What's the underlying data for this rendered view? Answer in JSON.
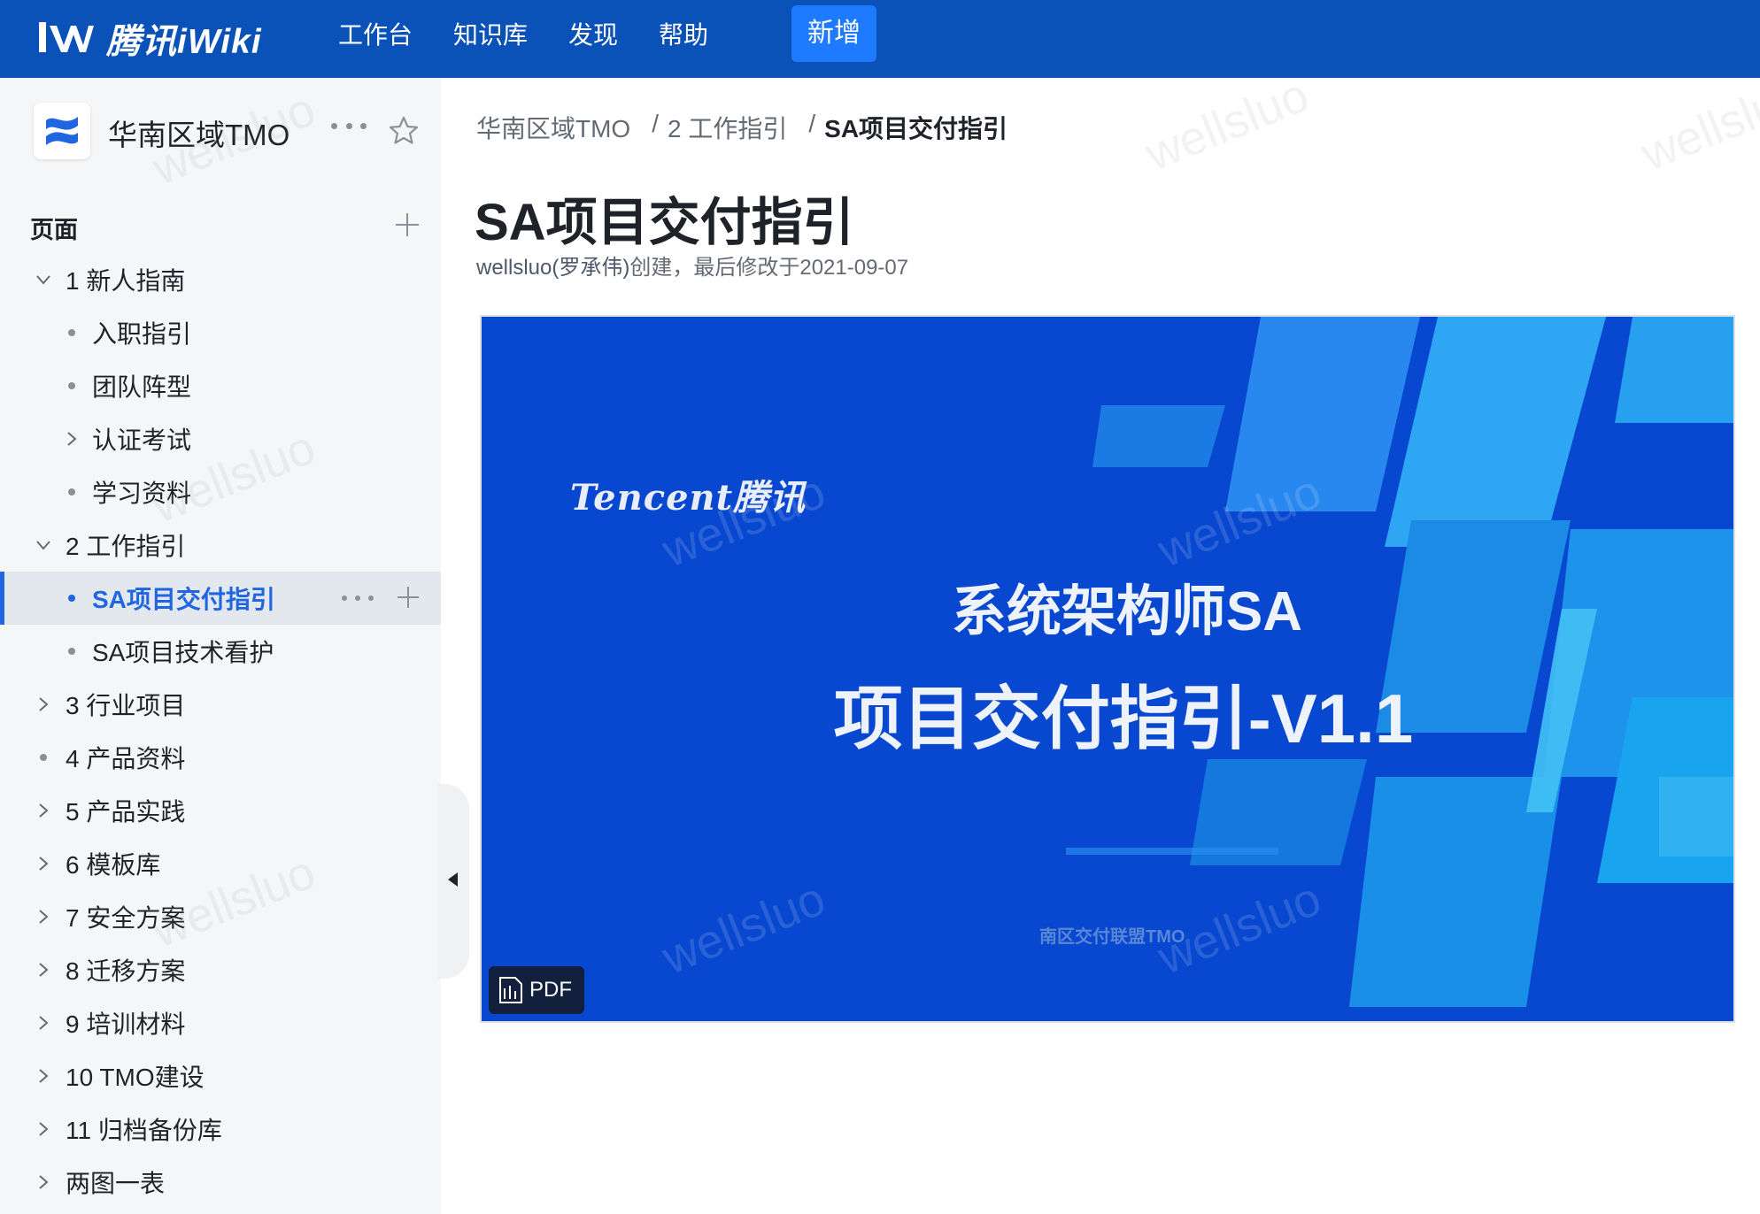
{
  "topbar": {
    "logo_text": "腾讯iWiki",
    "nav": [
      "工作台",
      "知识库",
      "发现",
      "帮助"
    ],
    "new_button": "新增"
  },
  "space": {
    "name": "华南区域TMO"
  },
  "sidebar": {
    "pages_title": "页面",
    "tree": [
      {
        "label": "1 新人指南",
        "level": 1,
        "control": "chevron-down"
      },
      {
        "label": "入职指引",
        "level": 2,
        "control": "dot"
      },
      {
        "label": "团队阵型",
        "level": 2,
        "control": "dot"
      },
      {
        "label": "认证考试",
        "level": 2,
        "control": "chevron-right"
      },
      {
        "label": "学习资料",
        "level": 2,
        "control": "dot"
      },
      {
        "label": "2 工作指引",
        "level": 1,
        "control": "chevron-down"
      },
      {
        "label": "SA项目交付指引",
        "level": 2,
        "control": "dot",
        "active": true
      },
      {
        "label": "SA项目技术看护",
        "level": 2,
        "control": "dot"
      },
      {
        "label": "3 行业项目",
        "level": 1,
        "control": "chevron-right"
      },
      {
        "label": "4 产品资料",
        "level": 1,
        "control": "dot"
      },
      {
        "label": "5 产品实践",
        "level": 1,
        "control": "chevron-right"
      },
      {
        "label": "6 模板库",
        "level": 1,
        "control": "chevron-right"
      },
      {
        "label": "7 安全方案",
        "level": 1,
        "control": "chevron-right"
      },
      {
        "label": "8 迁移方案",
        "level": 1,
        "control": "chevron-right"
      },
      {
        "label": "9 培训材料",
        "level": 1,
        "control": "chevron-right"
      },
      {
        "label": "10 TMO建设",
        "level": 1,
        "control": "chevron-right"
      },
      {
        "label": "11 归档备份库",
        "level": 1,
        "control": "chevron-right"
      },
      {
        "label": "两图一表",
        "level": 1,
        "control": "chevron-right"
      }
    ]
  },
  "breadcrumb": {
    "items": [
      "华南区域TMO",
      "2 工作指引",
      "SA项目交付指引"
    ],
    "separator": "/"
  },
  "page": {
    "title": "SA项目交付指引",
    "author": "wellsluo(罗承伟)",
    "meta_rest": "创建，最后修改于2021-09-07"
  },
  "preview": {
    "brand": "Tencent腾讯",
    "line1": "系统架构师SA",
    "line2": "项目交付指引-V1.1",
    "footer": "南区交付联盟TMO",
    "badge": "PDF"
  },
  "watermark": "wellsluo",
  "colors": {
    "topbar": "#0a52b8",
    "accent": "#1f66e0",
    "new_button": "#1e7bff",
    "slide_bg": "#0848d0"
  }
}
